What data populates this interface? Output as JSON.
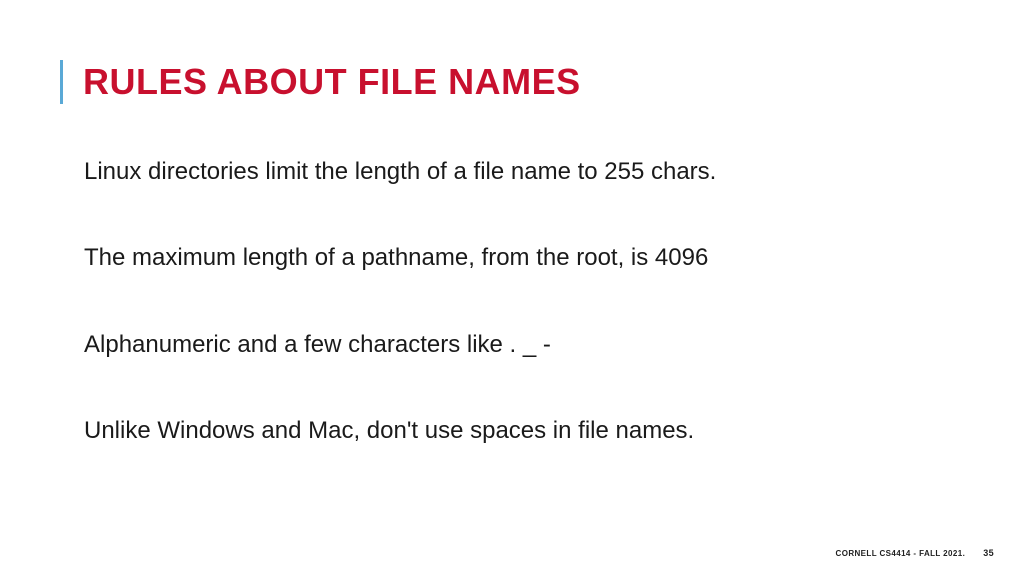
{
  "slide": {
    "title": "RULES ABOUT FILE NAMES",
    "lines": [
      "Linux directories limit the length of a file name to 255 chars.",
      "The maximum length of a pathname, from the root, is 4096",
      "Alphanumeric and a few characters like . _ -",
      "Unlike Windows and Mac, don't use spaces in file names."
    ]
  },
  "footer": {
    "course": "CORNELL CS4414 - FALL 2021.",
    "page": "35"
  }
}
